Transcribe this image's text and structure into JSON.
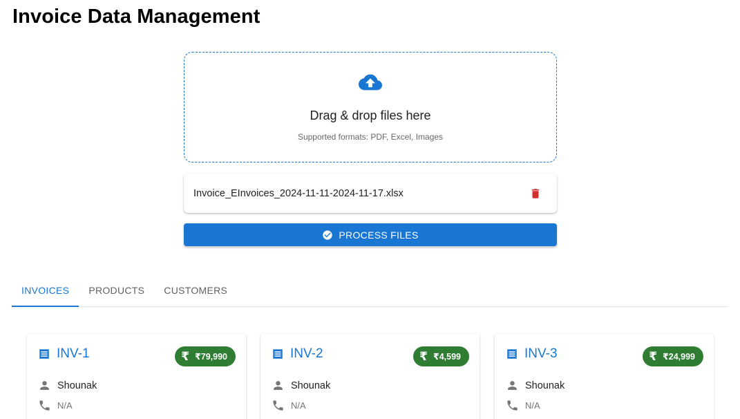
{
  "header": {
    "title": "Invoice Data Management"
  },
  "upload": {
    "title": "Drag & drop files here",
    "subtitle": "Supported formats: PDF, Excel, Images",
    "icon": "cloud-upload-icon"
  },
  "files": [
    {
      "name": "Invoice_EInvoices_2024-11-11-2024-11-17.xlsx",
      "delete_icon": "trash-icon"
    }
  ],
  "process_button": {
    "label": "PROCESS FILES",
    "icon": "check-circle-icon"
  },
  "tabs": [
    {
      "label": "INVOICES",
      "active": true
    },
    {
      "label": "PRODUCTS",
      "active": false
    },
    {
      "label": "CUSTOMERS",
      "active": false
    }
  ],
  "invoices": [
    {
      "id": "INV-1",
      "amount": "₹79,990",
      "customer": "Shounak",
      "phone": "N/A"
    },
    {
      "id": "INV-2",
      "amount": "₹4,599",
      "customer": "Shounak",
      "phone": "N/A"
    },
    {
      "id": "INV-3",
      "amount": "₹24,999",
      "customer": "Shounak",
      "phone": "N/A"
    }
  ],
  "colors": {
    "primary": "#1976d2",
    "danger": "#d32f2f",
    "success": "#2e7d32",
    "muted_icon": "#757575"
  }
}
